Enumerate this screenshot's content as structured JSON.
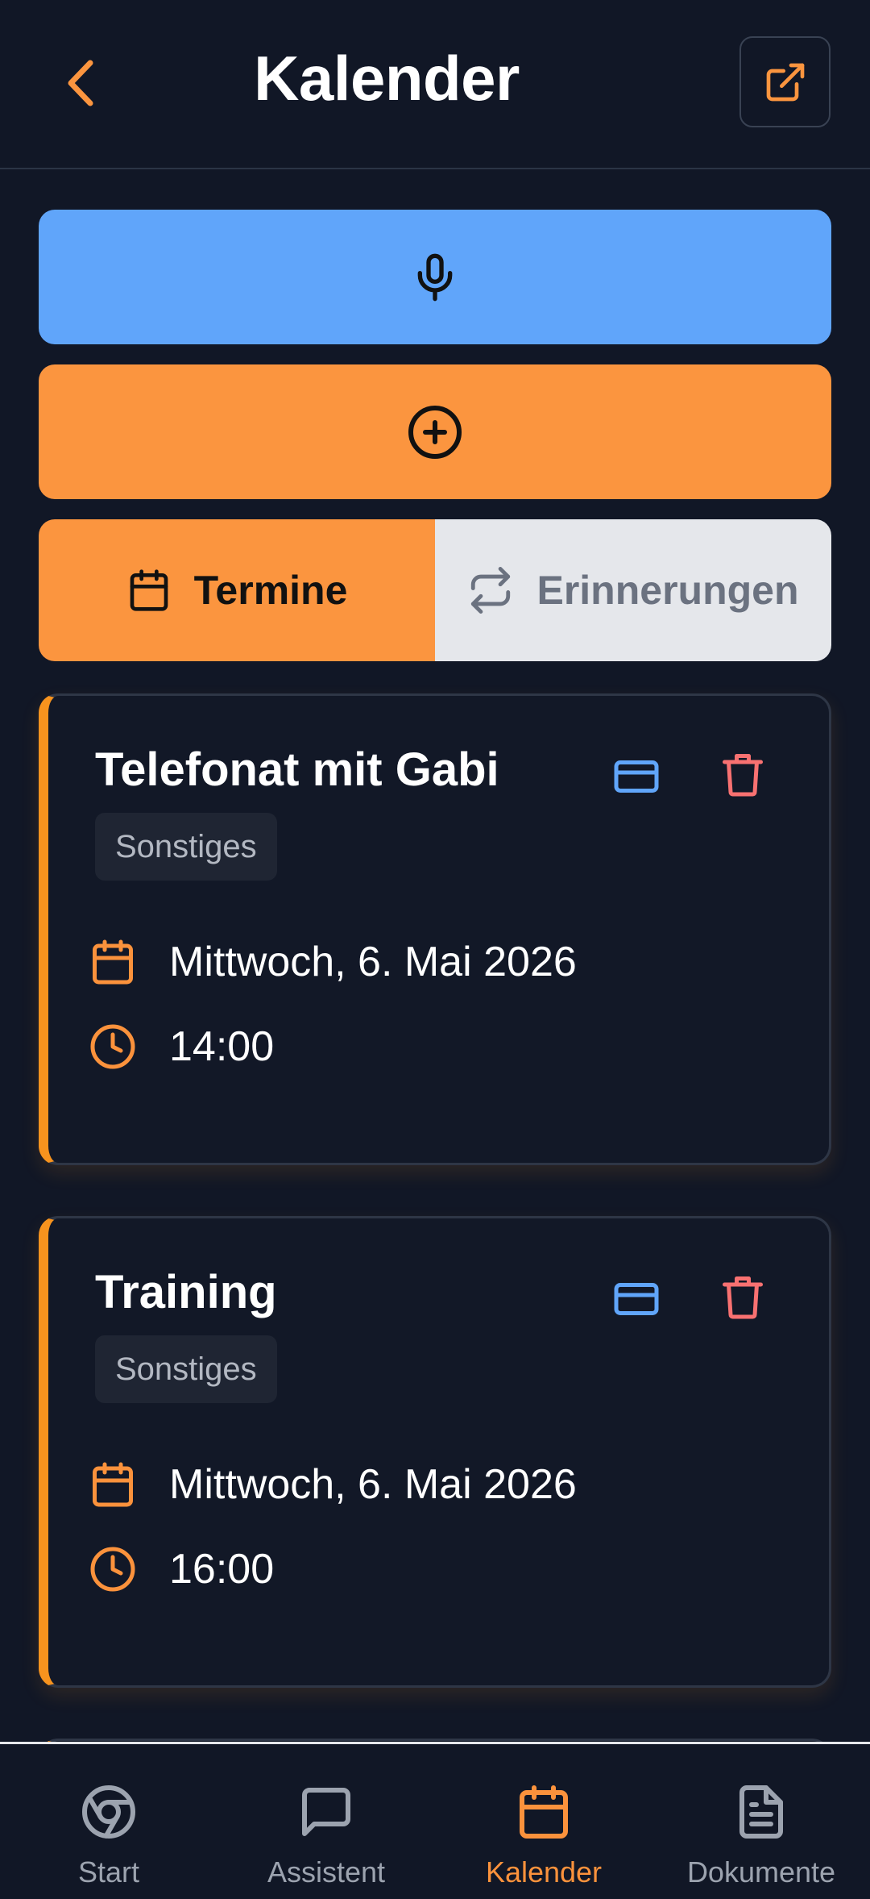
{
  "header": {
    "title": "Kalender"
  },
  "actions": {
    "voice_icon": "microphone-icon",
    "add_icon": "plus-circle-icon"
  },
  "tabs": [
    {
      "label": "Termine",
      "icon": "calendar-icon",
      "active": true
    },
    {
      "label": "Erinnerungen",
      "icon": "repeat-icon",
      "active": false
    }
  ],
  "events": [
    {
      "title": "Telefonat mit Gabi",
      "category": "Sonstiges",
      "date": "Mittwoch, 6. Mai 2026",
      "time": "14:00"
    },
    {
      "title": "Training",
      "category": "Sonstiges",
      "date": "Mittwoch, 6. Mai 2026",
      "time": "16:00"
    }
  ],
  "nav": [
    {
      "label": "Start",
      "icon": "chrome-icon",
      "active": false
    },
    {
      "label": "Assistent",
      "icon": "chat-icon",
      "active": false
    },
    {
      "label": "Kalender",
      "icon": "calendar-icon",
      "active": true
    },
    {
      "label": "Dokumente",
      "icon": "document-icon",
      "active": false
    }
  ],
  "colors": {
    "background": "#111726",
    "accent": "#fb953f",
    "voice": "#60a5fa",
    "edit": "#60a5fa",
    "delete": "#f87171"
  }
}
